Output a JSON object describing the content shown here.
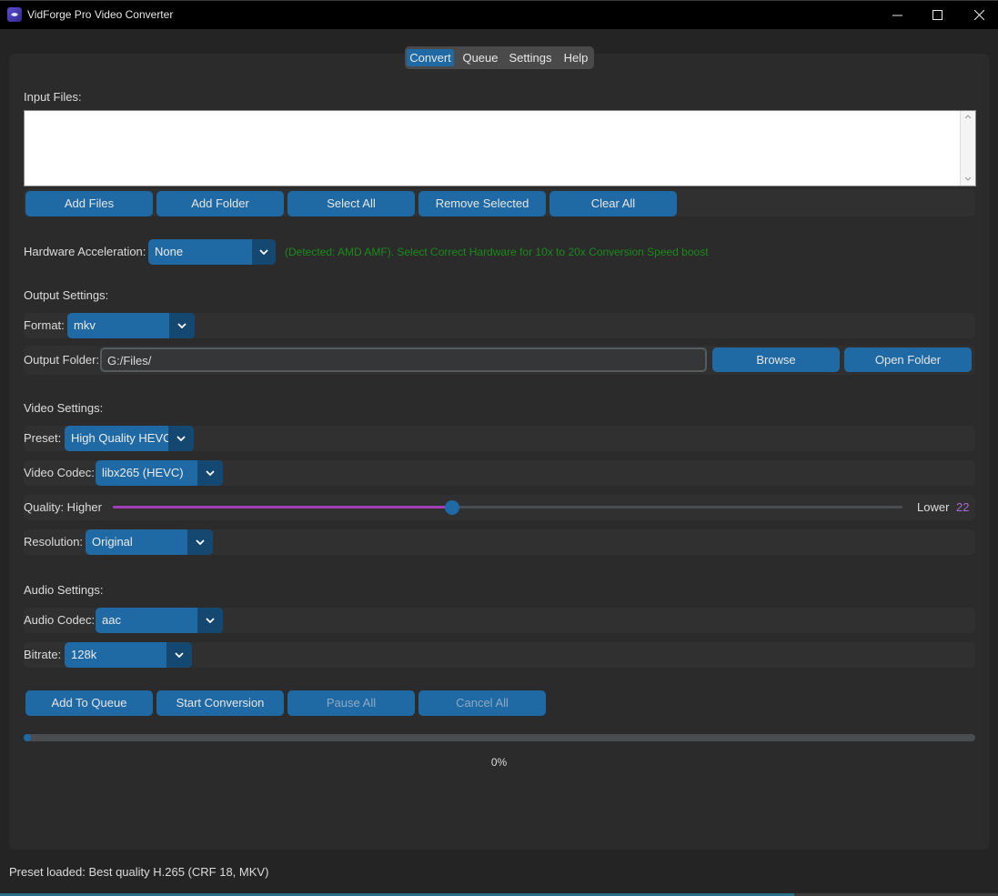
{
  "window": {
    "title": "VidForge Pro Video Converter",
    "icon": "app-logo-icon",
    "controls": [
      "minimize-icon",
      "maximize-icon",
      "close-icon"
    ]
  },
  "tabs": [
    {
      "label": "Convert",
      "active": true
    },
    {
      "label": "Queue",
      "active": false
    },
    {
      "label": "Settings",
      "active": false
    },
    {
      "label": "Help",
      "active": false
    }
  ],
  "input": {
    "label": "Input Files:",
    "buttons": {
      "add_files": "Add Files",
      "add_folder": "Add Folder",
      "select_all": "Select All",
      "remove_selected": "Remove Selected",
      "clear_all": "Clear All"
    }
  },
  "hardware": {
    "label": "Hardware Acceleration:",
    "value": "None",
    "hint": "(Detected: AMD AMF). Select Correct Hardware for 10x to 20x Conversion Speed boost",
    "hint_color": "#1a8a1a"
  },
  "output": {
    "section_label": "Output Settings:",
    "format_label": "Format:",
    "format_value": "mkv",
    "folder_label": "Output Folder:",
    "folder_value": "G:/Files/",
    "browse": "Browse",
    "open_folder": "Open Folder"
  },
  "video": {
    "section_label": "Video Settings:",
    "preset_label": "Preset:",
    "preset_value": "High Quality HEVC",
    "codec_label": "Video Codec:",
    "codec_value": "libx265 (HEVC)",
    "quality_label": "Quality: Higher",
    "quality_lower": "Lower",
    "quality_value": "22",
    "quality_fraction": 0.43,
    "resolution_label": "Resolution:",
    "resolution_value": "Original"
  },
  "audio": {
    "section_label": "Audio Settings:",
    "codec_label": "Audio Codec:",
    "codec_value": "aac",
    "bitrate_label": "Bitrate:",
    "bitrate_value": "128k"
  },
  "actions": {
    "add_to_queue": "Add To Queue",
    "start_conversion": "Start Conversion",
    "pause_all": "Pause All",
    "cancel_all": "Cancel All"
  },
  "progress": {
    "value_fraction": 0.0,
    "label": "0%"
  },
  "status": {
    "text": "Preset loaded: Best quality H.265 (CRF 18, MKV)"
  },
  "colors": {
    "accent": "#1f6aa5",
    "slider_fill": "#a23fb6",
    "quality_value": "#a96ad1"
  }
}
